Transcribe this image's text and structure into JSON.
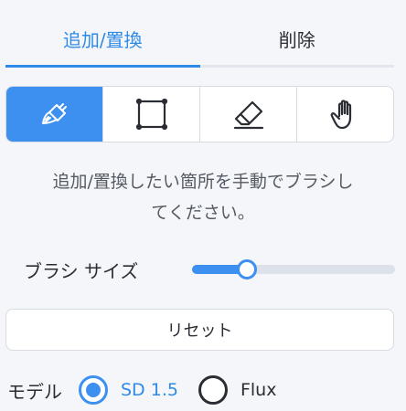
{
  "tabs": [
    {
      "label": "追加/置換",
      "active": true
    },
    {
      "label": "削除",
      "active": false
    }
  ],
  "tools": [
    {
      "icon": "brush-icon",
      "active": true
    },
    {
      "icon": "crop-rectangle-icon",
      "active": false
    },
    {
      "icon": "eraser-icon",
      "active": false
    },
    {
      "icon": "hand-icon",
      "active": false
    }
  ],
  "instruction": {
    "line1": "追加/置換したい箇所を手動でブラシし",
    "line2": "てください。"
  },
  "brush": {
    "label": "ブラシ サイズ",
    "value_fraction": 0.27
  },
  "reset": {
    "label": "リセット"
  },
  "model": {
    "label": "モデル",
    "options": [
      {
        "label": "SD 1.5",
        "selected": true
      },
      {
        "label": "Flux",
        "selected": false
      }
    ]
  },
  "colors": {
    "accent": "#3d8ff0",
    "tab_active_text": "#2e8ae6",
    "background": "#f4f6fa"
  }
}
